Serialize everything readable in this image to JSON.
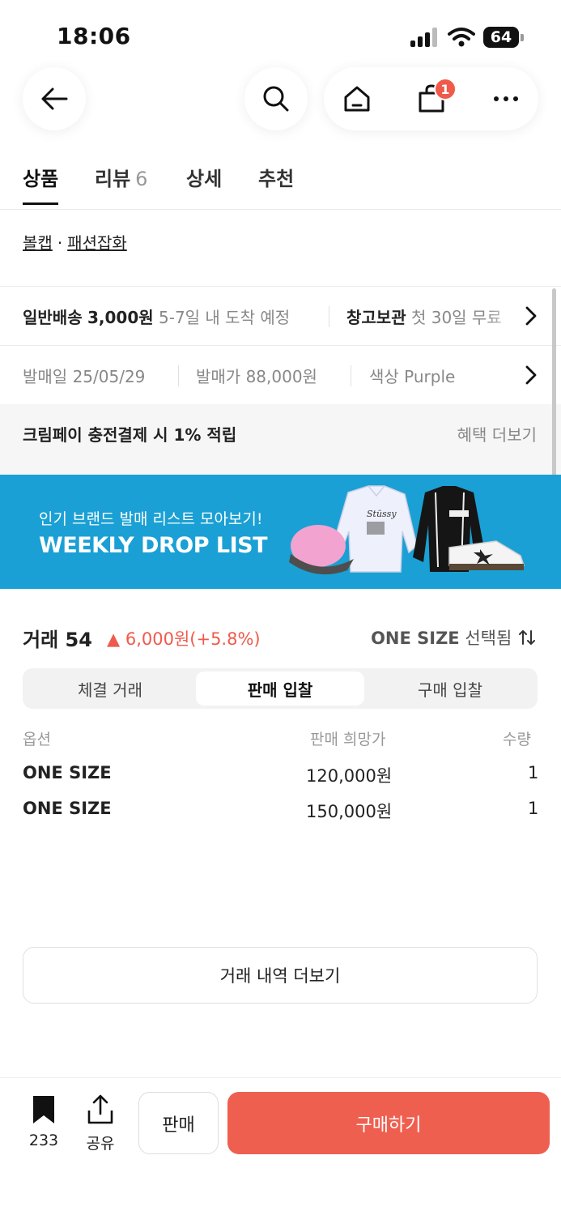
{
  "status_bar": {
    "time": "18:06",
    "battery": "64"
  },
  "nav": {
    "cart_badge": "1"
  },
  "tabs": [
    {
      "label": "상품",
      "active": true
    },
    {
      "label": "리뷰",
      "count": "6"
    },
    {
      "label": "상세"
    },
    {
      "label": "추천"
    }
  ],
  "breadcrumb": {
    "brand": "볼캡",
    "separator": "·",
    "category": "패션잡화"
  },
  "shipping": {
    "label": "일반배송",
    "fee": "3,000원",
    "eta": "5-7일 내 도착 예정",
    "storage_label": "창고보관",
    "storage_text": "첫 30일 무료"
  },
  "release": {
    "date_label": "발매일",
    "date": "25/05/29",
    "price_label": "발매가",
    "price": "88,000원",
    "color_label": "색상",
    "color": "Purple"
  },
  "cream_pay": {
    "text_pre": "크림페이 충전결제 시 ",
    "text_bold": "1%",
    "text_post": " 적립",
    "more": "혜택 더보기"
  },
  "banner": {
    "subtitle": "인기 브랜드 발매 리스트 모아보기!",
    "title": "WEEKLY DROP LIST"
  },
  "trade": {
    "label": "거래",
    "count": "54",
    "change_arrow": "▲",
    "change": "6,000원(+5.8%)",
    "size_value": "ONE SIZE",
    "size_suffix": "선택됨"
  },
  "segments": [
    {
      "label": "체결 거래"
    },
    {
      "label": "판매 입찰",
      "active": true
    },
    {
      "label": "구매 입찰"
    }
  ],
  "table": {
    "headers": {
      "option": "옵션",
      "price": "판매 희망가",
      "qty": "수량"
    },
    "rows": [
      {
        "option": "ONE SIZE",
        "price": "120,000원",
        "qty": "1"
      },
      {
        "option": "ONE SIZE",
        "price": "150,000원",
        "qty": "1"
      }
    ]
  },
  "more_button": "거래 내역 더보기",
  "bottom": {
    "bookmark_count": "233",
    "share_label": "공유",
    "sell_label": "판매",
    "buy_label": "구매하기"
  },
  "colors": {
    "accent": "#ef5f50",
    "banner": "#1aa0d4"
  }
}
